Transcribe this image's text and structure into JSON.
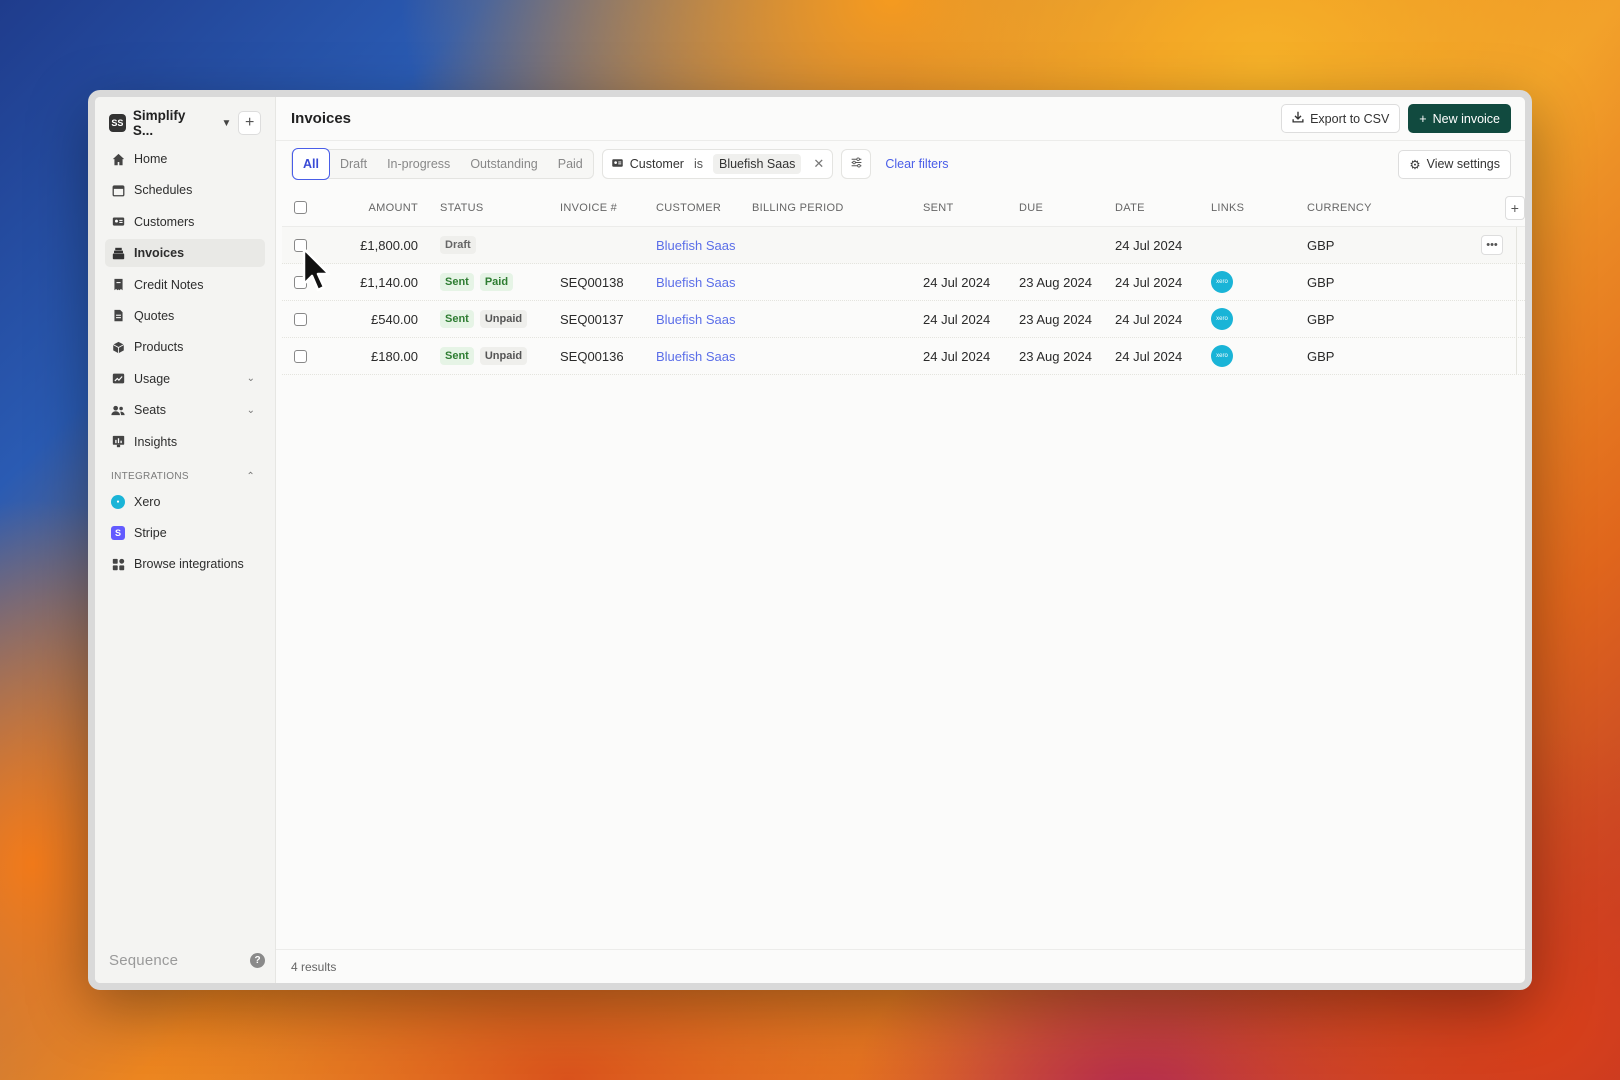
{
  "workspace": {
    "initials": "SS",
    "name": "Simplify S..."
  },
  "sidebar": {
    "items": [
      {
        "label": "Home",
        "icon": "home-icon"
      },
      {
        "label": "Schedules",
        "icon": "calendar-icon"
      },
      {
        "label": "Customers",
        "icon": "id-card-icon"
      },
      {
        "label": "Invoices",
        "icon": "invoice-stack-icon",
        "active": true
      },
      {
        "label": "Credit Notes",
        "icon": "credit-note-icon"
      },
      {
        "label": "Quotes",
        "icon": "quote-icon"
      },
      {
        "label": "Products",
        "icon": "cube-icon"
      },
      {
        "label": "Usage",
        "icon": "chart-icon",
        "expandable": true
      },
      {
        "label": "Seats",
        "icon": "users-icon",
        "expandable": true
      },
      {
        "label": "Insights",
        "icon": "insights-icon"
      }
    ],
    "integrations_label": "INTEGRATIONS",
    "integrations": [
      {
        "label": "Xero",
        "icon": "xero-icon"
      },
      {
        "label": "Stripe",
        "icon": "stripe-icon"
      },
      {
        "label": "Browse integrations",
        "icon": "grid-icon"
      }
    ],
    "brand": "Sequence"
  },
  "header": {
    "title": "Invoices",
    "export_label": "Export to CSV",
    "new_label": "New invoice"
  },
  "filters": {
    "tabs": [
      "All",
      "Draft",
      "In-progress",
      "Outstanding",
      "Paid"
    ],
    "active_tab": "All",
    "chip": {
      "field": "Customer",
      "operator": "is",
      "value": "Bluefish Saas"
    },
    "clear_label": "Clear filters",
    "view_settings_label": "View settings"
  },
  "table": {
    "columns": [
      "AMOUNT",
      "STATUS",
      "INVOICE #",
      "CUSTOMER",
      "BILLING PERIOD",
      "SENT",
      "DUE",
      "DATE",
      "LINKS",
      "CURRENCY"
    ],
    "rows": [
      {
        "amount": "£1,800.00",
        "status": [
          "Draft"
        ],
        "invoice": "",
        "customer": "Bluefish Saas",
        "billing": "",
        "sent": "",
        "due": "",
        "date": "24 Jul 2024",
        "link": false,
        "currency": "GBP"
      },
      {
        "amount": "£1,140.00",
        "status": [
          "Sent",
          "Paid"
        ],
        "invoice": "SEQ00138",
        "customer": "Bluefish Saas",
        "billing": "",
        "sent": "24 Jul 2024",
        "due": "23 Aug 2024",
        "date": "24 Jul 2024",
        "link": true,
        "currency": "GBP"
      },
      {
        "amount": "£540.00",
        "status": [
          "Sent",
          "Unpaid"
        ],
        "invoice": "SEQ00137",
        "customer": "Bluefish Saas",
        "billing": "",
        "sent": "24 Jul 2024",
        "due": "23 Aug 2024",
        "date": "24 Jul 2024",
        "link": true,
        "currency": "GBP"
      },
      {
        "amount": "£180.00",
        "status": [
          "Sent",
          "Unpaid"
        ],
        "invoice": "SEQ00136",
        "customer": "Bluefish Saas",
        "billing": "",
        "sent": "24 Jul 2024",
        "due": "23 Aug 2024",
        "date": "24 Jul 2024",
        "link": true,
        "currency": "GBP"
      }
    ],
    "xero_link_text": "xero"
  },
  "footer": {
    "results": "4 results"
  },
  "colors": {
    "accent": "#4a5ee8",
    "primary_button": "#114a3f",
    "xero": "#1ab4d7",
    "stripe": "#635bff"
  }
}
